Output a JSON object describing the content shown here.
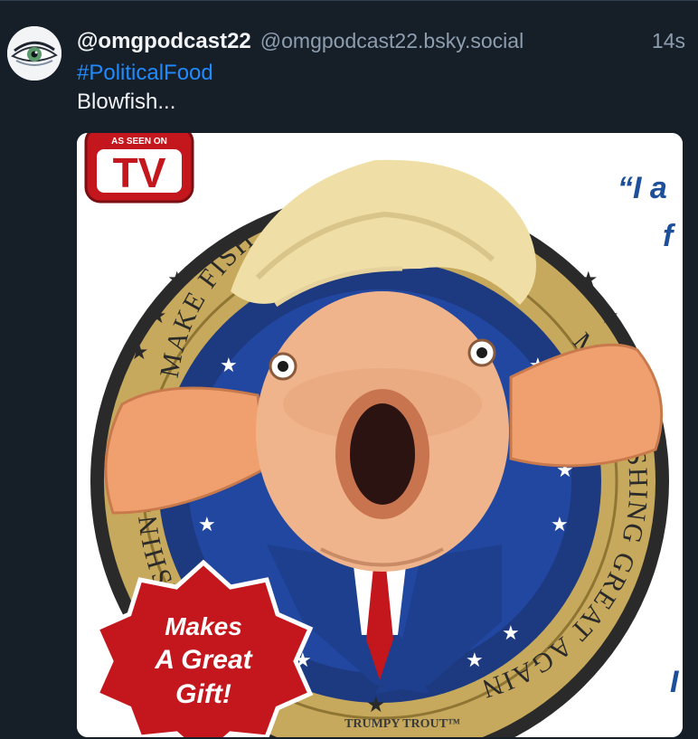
{
  "post": {
    "display_name": "@omgpodcast22",
    "handle": "@omgpodcast22.bsky.social",
    "timestamp": "14s",
    "hashtag": "#PoliticalFood",
    "text": "Blowfish..."
  },
  "image": {
    "tv_badge_top": "AS SEEN ON",
    "tv_badge_main": "TV",
    "seal_top_text": "MAKE FISH ... GAIN",
    "seal_right_text": "MAKE FISHING GREAT AGAIN",
    "seal_left_text": "MAKE FISHING GREAT",
    "seal_bottom_text": "TRUMPY TROUT™",
    "gift_line1": "Makes",
    "gift_line2": "A Great",
    "gift_line3": "Gift!",
    "quote_line1": "“I a",
    "quote_line2": "f",
    "quote_line3": "I"
  },
  "colors": {
    "background": "#161e27",
    "name_text": "#f1f3f5",
    "muted_text": "#8d9eb0",
    "hashtag": "#208bfe",
    "seal_blue": "#1d3a80",
    "seal_gold": "#c6a95c",
    "badge_red": "#c3171d"
  }
}
